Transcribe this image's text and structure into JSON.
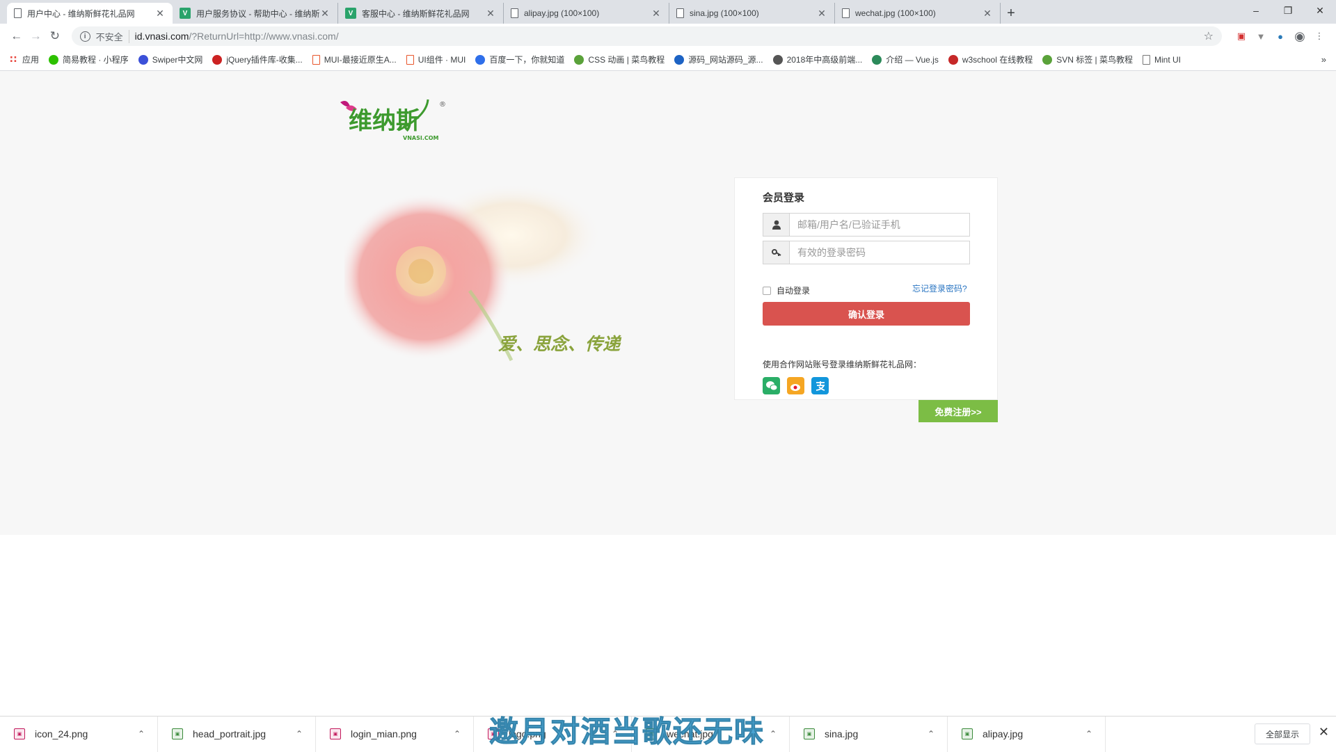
{
  "tabs": [
    {
      "title": "用户中心 - 维纳斯鲜花礼品网",
      "icon": "file-icon",
      "active": true
    },
    {
      "title": "用户服务协议 - 帮助中心 - 维纳斯",
      "icon": "site-logo-icon",
      "active": false
    },
    {
      "title": "客服中心 - 维纳斯鲜花礼品网",
      "icon": "site-logo-icon",
      "active": false
    },
    {
      "title": "alipay.jpg (100×100)",
      "icon": "file-icon",
      "active": false
    },
    {
      "title": "sina.jpg (100×100)",
      "icon": "file-icon",
      "active": false
    },
    {
      "title": "wechat.jpg (100×100)",
      "icon": "file-icon",
      "active": false
    }
  ],
  "address_bar": {
    "security_label": "不安全",
    "host": "id.vnasi.com",
    "path": "/?ReturnUrl=http://www.vnasi.com/"
  },
  "bookmarks": [
    {
      "label": "应用",
      "icon": "apps-grid-icon",
      "color": "#e8453c"
    },
    {
      "label": "简易教程 · 小程序",
      "icon": "wechat-icon",
      "color": "#2dc100"
    },
    {
      "label": "Swiper中文网",
      "icon": "swiper-icon",
      "color": "#3b50d8"
    },
    {
      "label": "jQuery插件库-收集...",
      "icon": "jquery-icon",
      "color": "#cc2222"
    },
    {
      "label": "MUI-最接近原生A...",
      "icon": "mui-icon",
      "color": "#e8552b"
    },
    {
      "label": "UI组件 · MUI",
      "icon": "mui-icon",
      "color": "#e8552b"
    },
    {
      "label": "百度一下，你就知道",
      "icon": "baidu-icon",
      "color": "#2f6fea"
    },
    {
      "label": "CSS 动画 | 菜鸟教程",
      "icon": "runoob-icon",
      "color": "#5aa23a"
    },
    {
      "label": "源码_网站源码_源...",
      "icon": "code-icon",
      "color": "#1d63c4"
    },
    {
      "label": "2018年中高级前端...",
      "icon": "segment-icon",
      "color": "#555555"
    },
    {
      "label": "介绍 — Vue.js",
      "icon": "vue-icon",
      "color": "#2c8a5a"
    },
    {
      "label": "w3school 在线教程",
      "icon": "w3school-icon",
      "color": "#c62828"
    },
    {
      "label": "SVN 标签 | 菜鸟教程",
      "icon": "runoob-icon",
      "color": "#5aa23a"
    },
    {
      "label": "Mint UI",
      "icon": "file-icon",
      "color": "#777777"
    }
  ],
  "page": {
    "brand_name": "维纳斯",
    "brand_domain": "VNASI.COM",
    "brand_mark": "®",
    "slogan": "爱、思念、传递"
  },
  "login": {
    "title": "会员登录",
    "username_placeholder": "邮箱/用户名/已验证手机",
    "password_placeholder": "有效的登录密码",
    "remember_label": "自动登录",
    "forgot_label": "忘记登录密码?",
    "submit_label": "确认登录",
    "partner_text": "使用合作网站账号登录维纳斯鲜花礼品网：",
    "partners": [
      {
        "name": "wechat-icon",
        "color": "#2aae67"
      },
      {
        "name": "weibo-icon",
        "color": "#e6162d"
      },
      {
        "name": "alipay-icon",
        "color": "#1296db"
      }
    ],
    "register_label": "免费注册>>"
  },
  "downloads": [
    {
      "name": "alipay.jpg",
      "type": "jpg"
    },
    {
      "name": "sina.jpg",
      "type": "jpg"
    },
    {
      "name": "wechat.jpg",
      "type": "jpg"
    },
    {
      "name": "logo.png",
      "type": "png"
    },
    {
      "name": "login_mian.png",
      "type": "png"
    },
    {
      "name": "head_portrait.jpg",
      "type": "jpg"
    },
    {
      "name": "icon_24.png",
      "type": "png"
    }
  ],
  "downloads_show_all": "全部显示",
  "overlay_caption": "邀月对酒当歌还无味",
  "colors": {
    "login_button": "#d9534f",
    "register_button": "#7cbd45",
    "link": "#2a75c2",
    "page_bg": "#f7f7f7"
  }
}
